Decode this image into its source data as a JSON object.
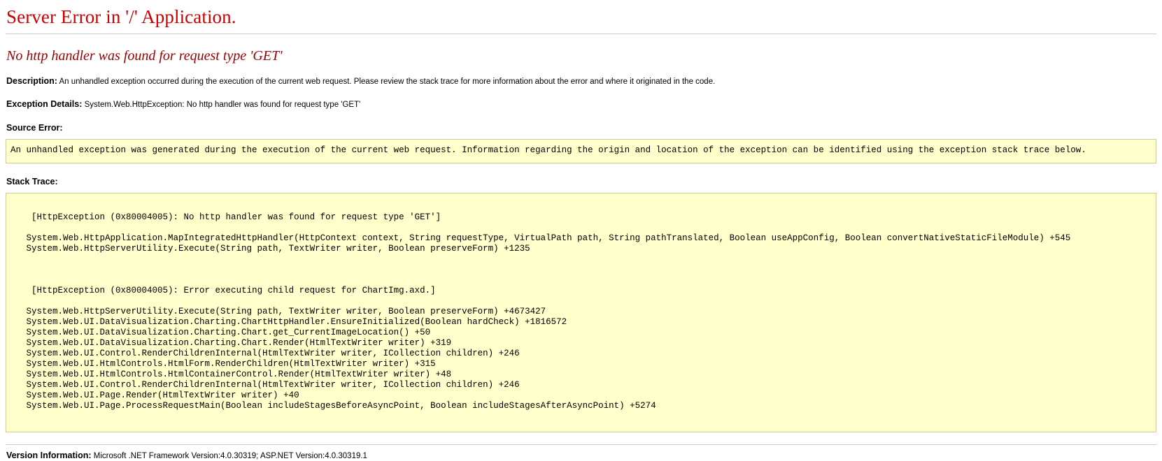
{
  "theme": {
    "title_color": "#cc0000",
    "subtitle_color": "#990000",
    "codebox_bg": "#ffffcc",
    "codebox_border": "#cccc99",
    "rule_color": "#cccccc",
    "text_color": "#000000"
  },
  "error": {
    "title": "Server Error in '/' Application.",
    "subtitle": "No http handler was found for request type 'GET'",
    "description_label": "Description:",
    "description_text": "An unhandled exception occurred during the execution of the current web request. Please review the stack trace for more information about the error and where it originated in the code.",
    "exception_details_label": "Exception Details:",
    "exception_details_text": "System.Web.HttpException: No http handler was found for request type 'GET'",
    "source_error_label": "Source Error:",
    "source_error_text": "An unhandled exception was generated during the execution of the current web request. Information regarding the origin and location of the exception can be identified using the exception stack trace below.",
    "stack_trace_label": "Stack Trace:",
    "stack_trace_block1_header": "[HttpException (0x80004005): No http handler was found for request type 'GET']",
    "stack_trace_block1_frames": [
      "   System.Web.HttpApplication.MapIntegratedHttpHandler(HttpContext context, String requestType, VirtualPath path, String pathTranslated, Boolean useAppConfig, Boolean convertNativeStaticFileModule) +545",
      "   System.Web.HttpServerUtility.Execute(String path, TextWriter writer, Boolean preserveForm) +1235"
    ],
    "stack_trace_block2_header": "[HttpException (0x80004005): Error executing child request for ChartImg.axd.]",
    "stack_trace_block2_frames": [
      "   System.Web.HttpServerUtility.Execute(String path, TextWriter writer, Boolean preserveForm) +4673427",
      "   System.Web.UI.DataVisualization.Charting.ChartHttpHandler.EnsureInitialized(Boolean hardCheck) +1816572",
      "   System.Web.UI.DataVisualization.Charting.Chart.get_CurrentImageLocation() +50",
      "   System.Web.UI.DataVisualization.Charting.Chart.Render(HtmlTextWriter writer) +319",
      "   System.Web.UI.Control.RenderChildrenInternal(HtmlTextWriter writer, ICollection children) +246",
      "   System.Web.UI.HtmlControls.HtmlForm.RenderChildren(HtmlTextWriter writer) +315",
      "   System.Web.UI.HtmlControls.HtmlContainerControl.Render(HtmlTextWriter writer) +48",
      "   System.Web.UI.Control.RenderChildrenInternal(HtmlTextWriter writer, ICollection children) +246",
      "   System.Web.UI.Page.Render(HtmlTextWriter writer) +40",
      "   System.Web.UI.Page.ProcessRequestMain(Boolean includeStagesBeforeAsyncPoint, Boolean includeStagesAfterAsyncPoint) +5274"
    ],
    "version_label": "Version Information:",
    "version_text": "Microsoft .NET Framework Version:4.0.30319; ASP.NET Version:4.0.30319.1"
  }
}
